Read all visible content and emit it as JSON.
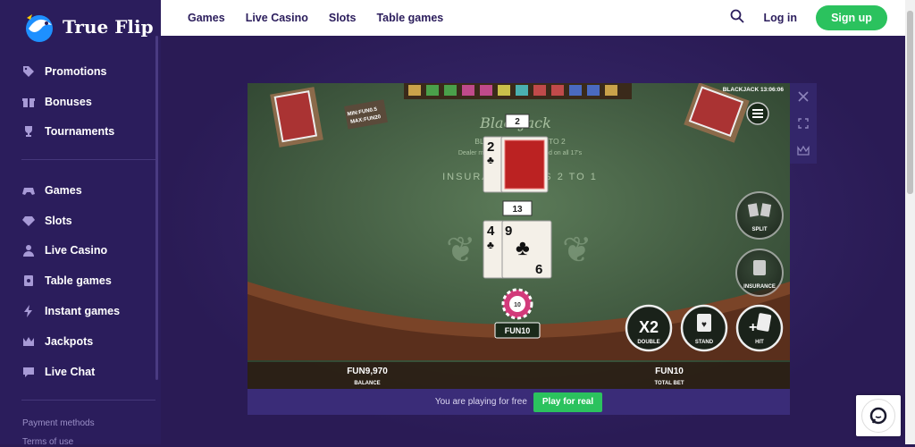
{
  "brand": {
    "name": "True Flip"
  },
  "sidebar": {
    "group1": [
      {
        "label": "Promotions",
        "icon": "tag-icon"
      },
      {
        "label": "Bonuses",
        "icon": "gift-icon"
      },
      {
        "label": "Tournaments",
        "icon": "trophy-icon"
      }
    ],
    "group2": [
      {
        "label": "Games",
        "icon": "gamepad-icon"
      },
      {
        "label": "Slots",
        "icon": "diamond-icon"
      },
      {
        "label": "Live Casino",
        "icon": "person-icon"
      },
      {
        "label": "Table games",
        "icon": "card-icon"
      },
      {
        "label": "Instant games",
        "icon": "lightning-icon"
      },
      {
        "label": "Jackpots",
        "icon": "crown-icon"
      },
      {
        "label": "Live Chat",
        "icon": "chat-icon"
      }
    ],
    "footer": [
      "Payment methods",
      "Terms of use"
    ]
  },
  "topnav": {
    "items": [
      "Games",
      "Live Casino",
      "Slots",
      "Table games"
    ],
    "login": "Log in",
    "signup": "Sign up"
  },
  "game": {
    "title": "BLACKJACK 13:06:06",
    "table_limits": [
      "MIN:FUN0.5",
      "MAX:FUN20"
    ],
    "felt_brand": "BlackJack",
    "felt_line1": "BLACKJACK PAYS 3 TO 2",
    "felt_line2": "Dealer must draw to 16 and stand on all 17's",
    "felt_insurance": "INSURANCE PAYS 2 TO 1",
    "dealer_score": "2",
    "player_score": "13",
    "dealer_card": "2",
    "player_cards": [
      "4",
      "9",
      "6"
    ],
    "chip_value": "10",
    "bet_label": "FUN10",
    "buttons": {
      "split": "SPLIT",
      "insurance": "INSURANCE",
      "double": "DOUBLE",
      "double_glyph": "X2",
      "stand": "STAND",
      "hit": "HIT"
    },
    "balance_value": "FUN9,970",
    "balance_label": "BALANCE",
    "total_bet_value": "FUN10",
    "total_bet_label": "TOTAL BET"
  },
  "bottom": {
    "free_text": "You are playing for free",
    "play_real": "Play for real"
  },
  "colors": {
    "brand_purple": "#2b1d5c",
    "green": "#2bc25e",
    "felt": "#4a6b4a"
  }
}
